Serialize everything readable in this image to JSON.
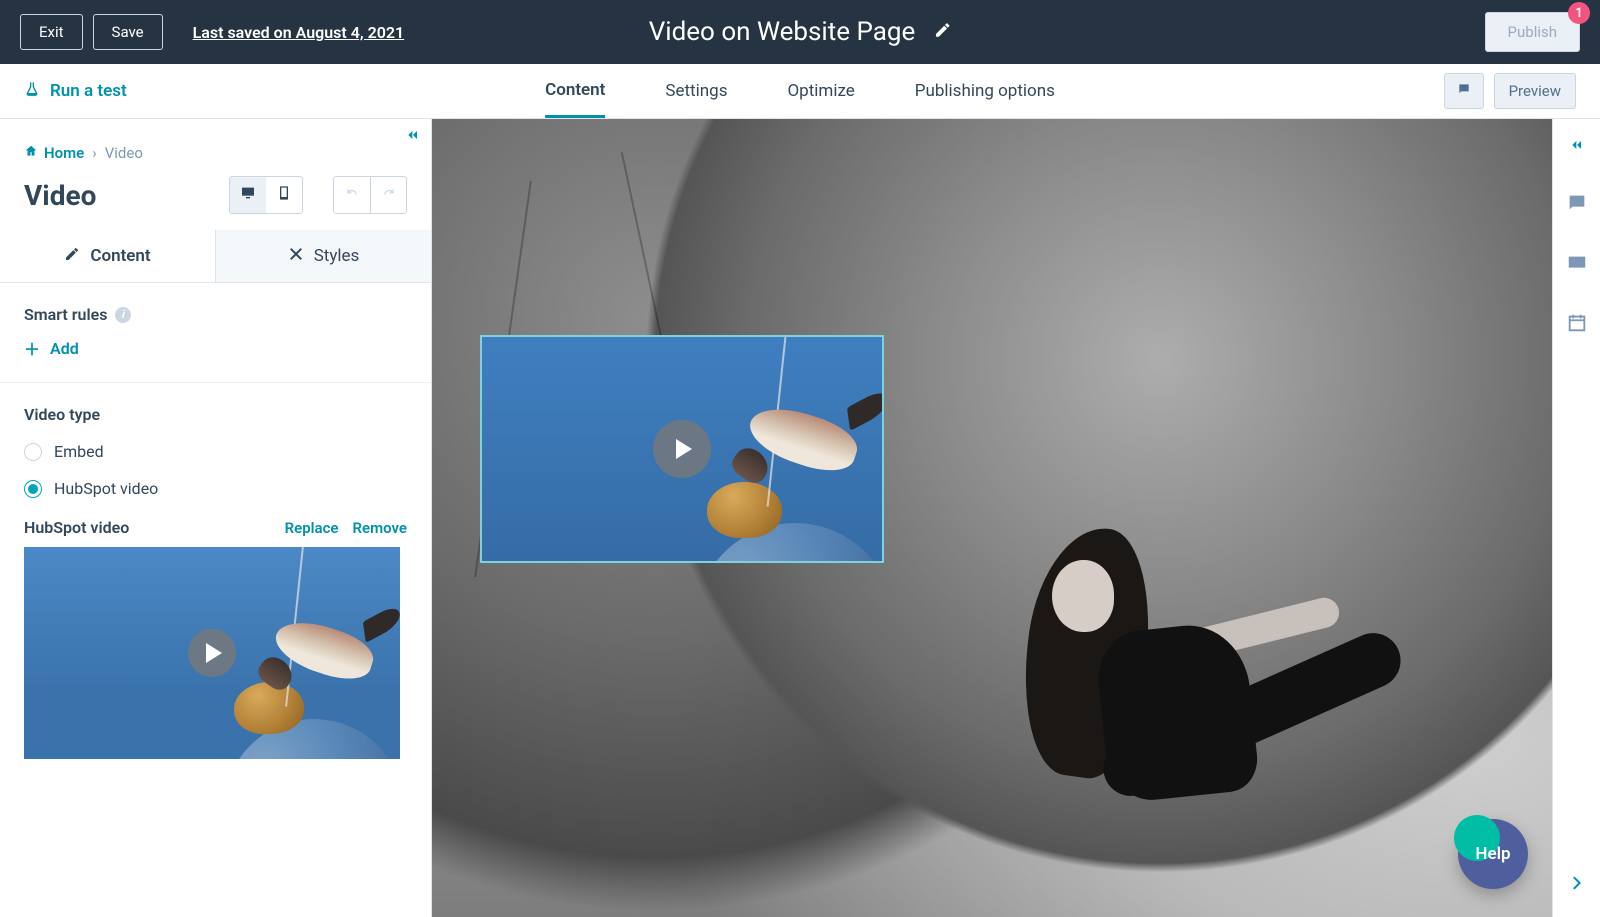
{
  "topbar": {
    "exit": "Exit",
    "save": "Save",
    "last_saved": "Last saved on August 4, 2021",
    "title": "Video on Website Page",
    "publish": "Publish",
    "badge": "1"
  },
  "secondbar": {
    "run_test": "Run a test",
    "tabs": {
      "content": "Content",
      "settings": "Settings",
      "optimize": "Optimize",
      "publishing": "Publishing options"
    },
    "preview": "Preview"
  },
  "leftpanel": {
    "breadcrumb_home": "Home",
    "breadcrumb_current": "Video",
    "title": "Video",
    "subtabs": {
      "content": "Content",
      "styles": "Styles"
    },
    "smart_rules_label": "Smart rules",
    "add_label": "Add",
    "video_type_label": "Video type",
    "option_embed": "Embed",
    "option_hubspot": "HubSpot video",
    "hubspot_video_label": "HubSpot video",
    "replace": "Replace",
    "remove": "Remove"
  },
  "help": "Help"
}
